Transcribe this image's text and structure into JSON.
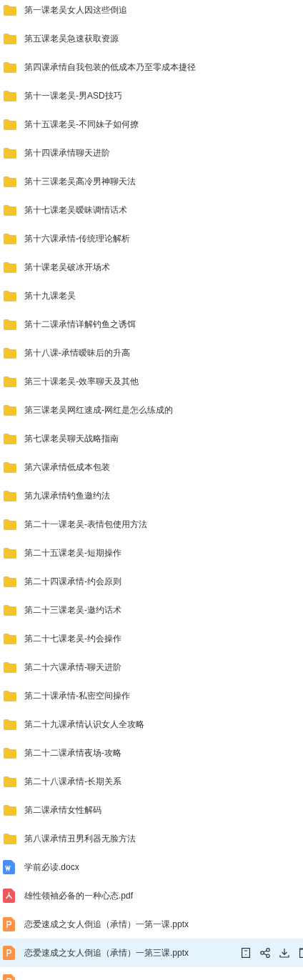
{
  "files": [
    {
      "kind": "folder",
      "name": "第一课老吴女人因这些倒追",
      "selected": false
    },
    {
      "kind": "folder",
      "name": "第五课老吴急速获取资源",
      "selected": false
    },
    {
      "kind": "folder",
      "name": "第四课承情自我包装的低成本乃至零成本捷径",
      "selected": false
    },
    {
      "kind": "folder",
      "name": "第十一课老吴-男ASD技巧",
      "selected": false
    },
    {
      "kind": "folder",
      "name": "第十五课老吴-不同妹子如何撩",
      "selected": false
    },
    {
      "kind": "folder",
      "name": "第十四课承情聊天进阶",
      "selected": false
    },
    {
      "kind": "folder",
      "name": "第十三课老吴高冷男神聊天法",
      "selected": false
    },
    {
      "kind": "folder",
      "name": "第十七课老吴暧昧调情话术",
      "selected": false
    },
    {
      "kind": "folder",
      "name": "第十六课承情-传统理论解析",
      "selected": false
    },
    {
      "kind": "folder",
      "name": "第十课老吴破冰开场术",
      "selected": false
    },
    {
      "kind": "folder",
      "name": "第十九课老吴",
      "selected": false
    },
    {
      "kind": "folder",
      "name": "第十二课承情详解钓鱼之诱饵",
      "selected": false
    },
    {
      "kind": "folder",
      "name": "第十八课-承情暧昧后的升高",
      "selected": false
    },
    {
      "kind": "folder",
      "name": "第三十课老吴-效率聊天及其他",
      "selected": false
    },
    {
      "kind": "folder",
      "name": "第三课老吴网红速成-网红是怎么练成的",
      "selected": false
    },
    {
      "kind": "folder",
      "name": "第七课老吴聊天战略指南",
      "selected": false
    },
    {
      "kind": "folder",
      "name": "第六课承情低成本包装",
      "selected": false
    },
    {
      "kind": "folder",
      "name": "第九课承情钓鱼邀约法",
      "selected": false
    },
    {
      "kind": "folder",
      "name": "第二十一课老吴-表情包使用方法",
      "selected": false
    },
    {
      "kind": "folder",
      "name": "第二十五课老吴-短期操作",
      "selected": false
    },
    {
      "kind": "folder",
      "name": "第二十四课承情-约会原则",
      "selected": false
    },
    {
      "kind": "folder",
      "name": "第二十三课老吴-邀约话术",
      "selected": false
    },
    {
      "kind": "folder",
      "name": "第二十七课老吴-约会操作",
      "selected": false
    },
    {
      "kind": "folder",
      "name": "第二十六课承情-聊天进阶",
      "selected": false
    },
    {
      "kind": "folder",
      "name": "第二十课承情-私密空间操作",
      "selected": false
    },
    {
      "kind": "folder",
      "name": "第二十九课承情认识女人全攻略",
      "selected": false
    },
    {
      "kind": "folder",
      "name": "第二十二课承情夜场-攻略",
      "selected": false
    },
    {
      "kind": "folder",
      "name": "第二十八课承情-长期关系",
      "selected": false
    },
    {
      "kind": "folder",
      "name": "第二课承情女性解码",
      "selected": false
    },
    {
      "kind": "folder",
      "name": "第八课承情丑男利器无脸方法",
      "selected": false
    },
    {
      "kind": "docx",
      "name": "学前必读.docx",
      "selected": false
    },
    {
      "kind": "pdf",
      "name": "雄性领袖必备的一种心态.pdf",
      "selected": false
    },
    {
      "kind": "pptx",
      "name": "恋爱速成之女人倒追（承情）一第一课.pptx",
      "selected": false
    },
    {
      "kind": "pptx",
      "name": "恋爱速成之女人倒追（承情）一第三课.pptx",
      "selected": true
    },
    {
      "kind": "pptx",
      "selected": false
    }
  ]
}
